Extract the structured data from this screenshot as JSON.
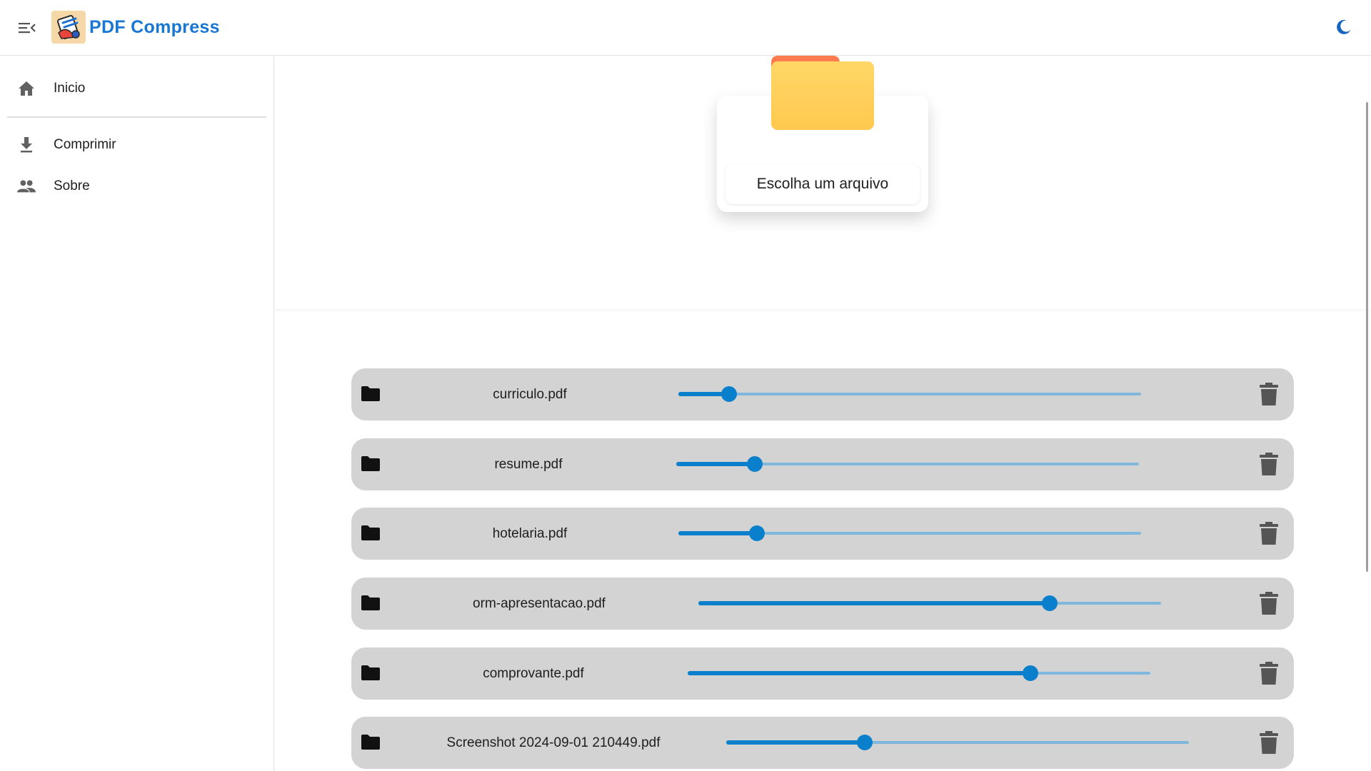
{
  "header": {
    "title": "PDF Compress",
    "menu_icon": "menu-open-icon",
    "logo_icon": "compress-logo-icon",
    "theme_icon": "moon-icon",
    "brand_color": "#1976d2"
  },
  "sidebar": {
    "items": [
      {
        "label": "Inicio",
        "icon": "home-icon"
      },
      {
        "label": "Comprimir",
        "icon": "download-icon"
      },
      {
        "label": "Sobre",
        "icon": "people-icon"
      }
    ]
  },
  "upload": {
    "button_label": "Escolha um arquivo",
    "icon": "folder-icon"
  },
  "files": [
    {
      "name": "curriculo.pdf",
      "compression": 0.11
    },
    {
      "name": "resume.pdf",
      "compression": 0.17
    },
    {
      "name": "hotelaria.pdf",
      "compression": 0.17
    },
    {
      "name": "orm-apresentacao.pdf",
      "compression": 0.76
    },
    {
      "name": "comprovante.pdf",
      "compression": 0.74
    },
    {
      "name": "Screenshot 2024-09-01 210449.pdf",
      "compression": 0.3
    }
  ],
  "colors": {
    "accent": "#0a7fcc",
    "track": "#7fb8dc",
    "row_background": "#d3d3d3",
    "folder": "#ffcf5c",
    "folder_tab": "#ff7a4d"
  }
}
